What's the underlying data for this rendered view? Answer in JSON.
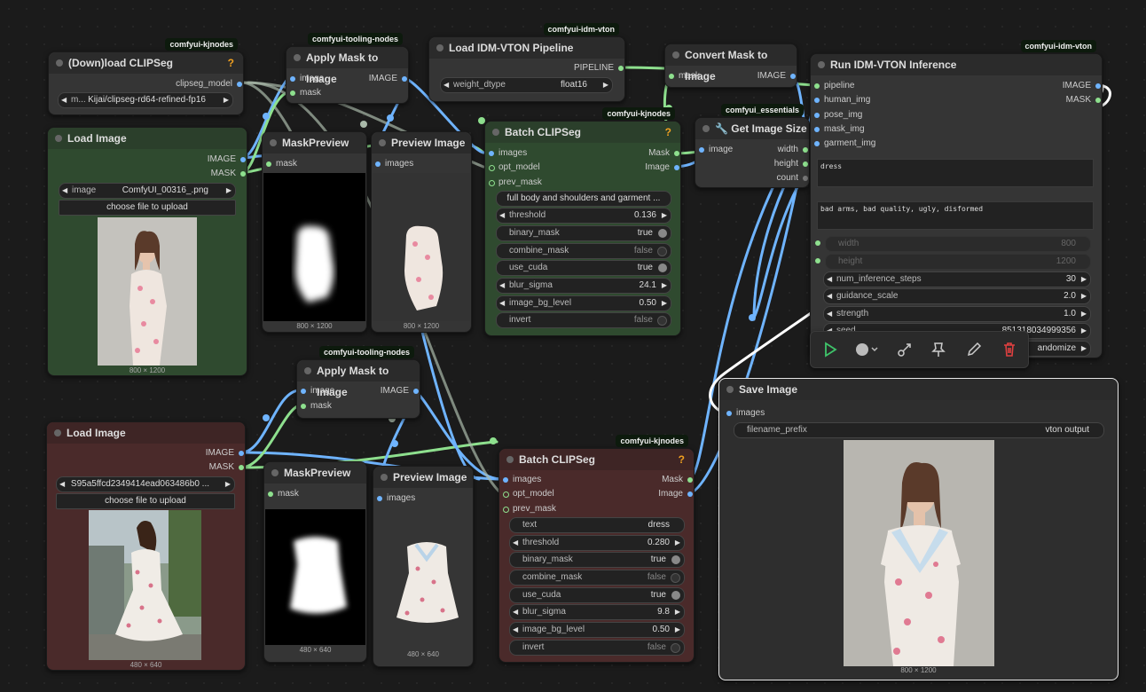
{
  "nodes": {
    "clipseg_loader": {
      "title": "(Down)load CLIPSeg",
      "badge": "comfyui-kjnodes",
      "help": "?",
      "output": "clipseg_model",
      "model_label": "m...",
      "model_value": "Kijai/clipseg-rd64-refined-fp16"
    },
    "load_image_1": {
      "title": "Load Image",
      "outputs": [
        "IMAGE",
        "MASK"
      ],
      "image_label": "image",
      "image_value": "ComfyUI_00316_.png",
      "upload": "choose file to upload",
      "size": "800 × 1200"
    },
    "apply_mask_1": {
      "title": "Apply Mask to Image",
      "badge": "comfyui-tooling-nodes",
      "inputs": [
        "image",
        "mask"
      ],
      "output": "IMAGE"
    },
    "mask_preview_1": {
      "title": "MaskPreview",
      "input": "mask",
      "size": "800 × 1200"
    },
    "preview_1": {
      "title": "Preview Image",
      "input": "images",
      "size": "800 × 1200"
    },
    "load_pipeline": {
      "title": "Load IDM-VTON Pipeline",
      "badge": "comfyui-idm-vton",
      "output": "PIPELINE",
      "dtype_label": "weight_dtype",
      "dtype_value": "float16"
    },
    "batch_clipseg_1": {
      "title": "Batch CLIPSeg",
      "badge": "comfyui-kjnodes",
      "help": "?",
      "inputs": [
        "images",
        "opt_model",
        "prev_mask"
      ],
      "outputs": [
        "Mask",
        "Image"
      ],
      "text_value": "full body and shoulders and garment ...",
      "widgets": [
        {
          "label": "threshold",
          "value": "0.136"
        },
        {
          "label": "binary_mask",
          "value": "true"
        },
        {
          "label": "combine_mask",
          "value": "false"
        },
        {
          "label": "use_cuda",
          "value": "true"
        },
        {
          "label": "blur_sigma",
          "value": "24.1"
        },
        {
          "label": "image_bg_level",
          "value": "0.50"
        },
        {
          "label": "invert",
          "value": "false"
        }
      ]
    },
    "convert_mask": {
      "title": "Convert Mask to Image",
      "input": "mask",
      "output": "IMAGE"
    },
    "get_size": {
      "title": "Get Image Size",
      "badge": "comfyui_essentials",
      "input": "image",
      "outputs": [
        "width",
        "height",
        "count"
      ]
    },
    "run_vton": {
      "title": "Run IDM-VTON Inference",
      "badge": "comfyui-idm-vton",
      "inputs": [
        "pipeline",
        "human_img",
        "pose_img",
        "mask_img",
        "garment_img"
      ],
      "outputs": [
        "IMAGE",
        "MASK"
      ],
      "prompt": "dress",
      "negative": "bad arms, bad quality, ugly, disformed",
      "width_label": "width",
      "width_value": "800",
      "height_label": "height",
      "height_value": "1200",
      "widgets": [
        {
          "label": "num_inference_steps",
          "value": "30"
        },
        {
          "label": "guidance_scale",
          "value": "2.0"
        },
        {
          "label": "strength",
          "value": "1.0"
        },
        {
          "label": "seed",
          "value": "851318034999356"
        }
      ],
      "control_partial": "andomize"
    },
    "apply_mask_2": {
      "title": "Apply Mask to Image",
      "badge": "comfyui-tooling-nodes",
      "inputs": [
        "image",
        "mask"
      ],
      "output": "IMAGE"
    },
    "load_image_2": {
      "title": "Load Image",
      "outputs": [
        "IMAGE",
        "MASK"
      ],
      "image_value": "S95a5ffcd2349414ead063486b0 ...",
      "upload": "choose file to upload",
      "size": "480 × 640"
    },
    "mask_preview_2": {
      "title": "MaskPreview",
      "input": "mask",
      "size": "480 × 640"
    },
    "preview_2": {
      "title": "Preview Image",
      "input": "images",
      "size": "480 × 640"
    },
    "batch_clipseg_2": {
      "title": "Batch CLIPSeg",
      "badge": "comfyui-kjnodes",
      "help": "?",
      "inputs": [
        "images",
        "opt_model",
        "prev_mask"
      ],
      "outputs": [
        "Mask",
        "Image"
      ],
      "widgets": [
        {
          "label": "text",
          "value": "dress"
        },
        {
          "label": "threshold",
          "value": "0.280"
        },
        {
          "label": "binary_mask",
          "value": "true"
        },
        {
          "label": "combine_mask",
          "value": "false"
        },
        {
          "label": "use_cuda",
          "value": "true"
        },
        {
          "label": "blur_sigma",
          "value": "9.8"
        },
        {
          "label": "image_bg_level",
          "value": "0.50"
        },
        {
          "label": "invert",
          "value": "false"
        }
      ]
    },
    "save_image": {
      "title": "Save Image",
      "input": "images",
      "prefix_label": "filename_prefix",
      "prefix_value": "vton output",
      "size": "800 × 1200"
    }
  },
  "toolbar": {
    "icons": [
      "play-icon",
      "color-icon",
      "bypass-icon",
      "pin-icon",
      "edit-icon",
      "delete-icon"
    ]
  },
  "colors": {
    "image_link": "#6fb4ff",
    "mask_link": "#8ee08e",
    "delete": "#e04040",
    "play": "#3fc46a"
  }
}
